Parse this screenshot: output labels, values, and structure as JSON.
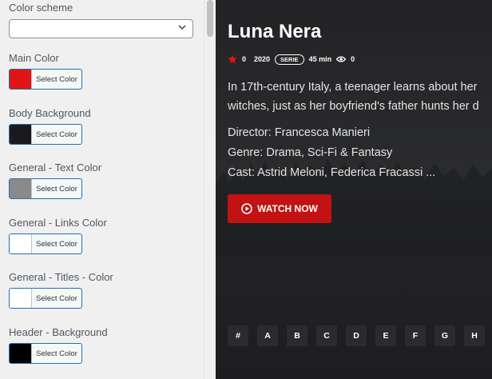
{
  "panel": {
    "color_scheme_label": "Color scheme",
    "color_scheme_value": "",
    "settings": [
      {
        "label": "Main Color",
        "button": "Select Color",
        "color": "#e01414"
      },
      {
        "label": "Body Background",
        "button": "Select Color",
        "color": "#1a1a1d"
      },
      {
        "label": "General - Text Color",
        "button": "Select Color",
        "color": "#8a8a8a"
      },
      {
        "label": "General - Links Color",
        "button": "Select Color",
        "color": "#ffffff"
      },
      {
        "label": "General - Titles - Color",
        "button": "Select Color",
        "color": "#ffffff"
      },
      {
        "label": "Header - Background",
        "button": "Select Color",
        "color": "#000000"
      }
    ]
  },
  "preview": {
    "title": "Luna Nera",
    "rating": "0",
    "year": "2020",
    "type_badge": "SERIE",
    "duration": "45 min",
    "views": "0",
    "description_lines": [
      "In 17th-century Italy, a teenager learns about her",
      "witches, just as her boyfriend's father hunts her d"
    ],
    "director": "Director: Francesca Manieri",
    "genre": "Genre: Drama, Sci-Fi & Fantasy",
    "cast": "Cast: Astrid Meloni, Federica Fracassi ...",
    "watch_label": "WATCH NOW",
    "letters": [
      "#",
      "A",
      "B",
      "C",
      "D",
      "E",
      "F",
      "G",
      "H"
    ],
    "accent_color": "#c21212"
  }
}
